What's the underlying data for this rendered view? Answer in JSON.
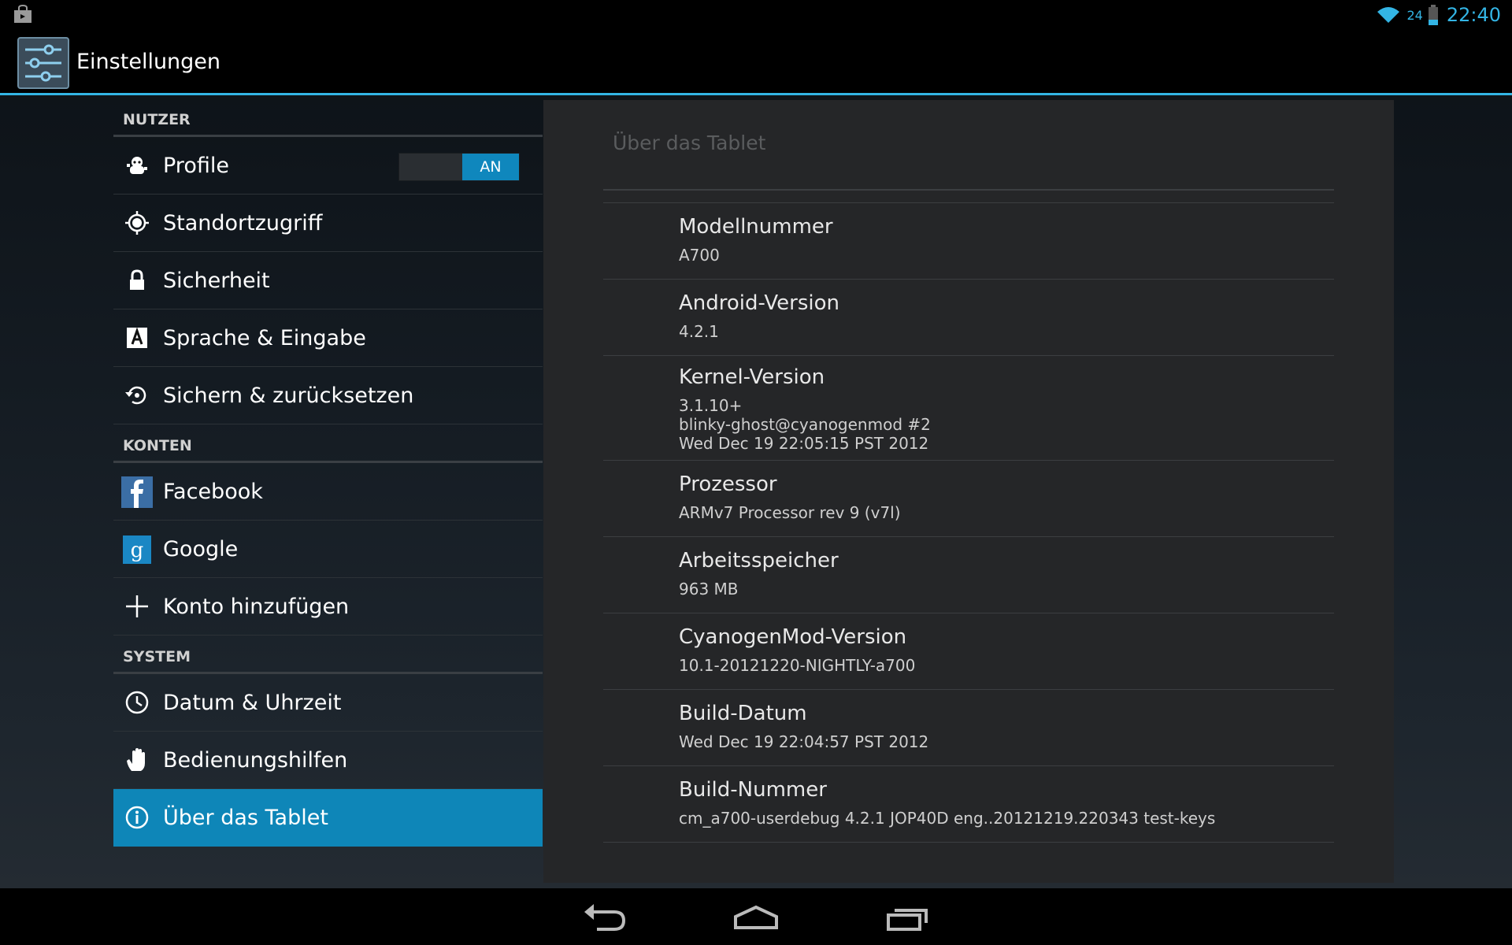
{
  "status_bar": {
    "battery_percent": "24",
    "time": "22:40",
    "accent_color": "#33b5e5"
  },
  "action_bar": {
    "title": "Einstellungen",
    "icon": "settings-sliders-icon"
  },
  "sidebar": {
    "sections": [
      {
        "header": "NUTZER"
      },
      {
        "header": "KONTEN"
      },
      {
        "header": "SYSTEM"
      }
    ],
    "items": [
      {
        "label": "Profile",
        "icon": "profile-icon",
        "toggle": "AN"
      },
      {
        "label": "Standortzugriff",
        "icon": "location-icon"
      },
      {
        "label": "Sicherheit",
        "icon": "lock-icon"
      },
      {
        "label": "Sprache & Eingabe",
        "icon": "language-icon"
      },
      {
        "label": "Sichern & zurücksetzen",
        "icon": "backup-restore-icon"
      },
      {
        "label": "Facebook",
        "icon": "facebook-icon"
      },
      {
        "label": "Google",
        "icon": "google-icon"
      },
      {
        "label": "Konto hinzufügen",
        "icon": "plus-icon"
      },
      {
        "label": "Datum & Uhrzeit",
        "icon": "clock-icon"
      },
      {
        "label": "Bedienungshilfen",
        "icon": "hand-icon"
      },
      {
        "label": "Über das Tablet",
        "icon": "info-icon",
        "selected": true
      }
    ],
    "selected_color": "#0e86b8"
  },
  "detail": {
    "title": "Über das Tablet",
    "rows": [
      {
        "title": "Modellnummer",
        "value": [
          "A700"
        ]
      },
      {
        "title": "Android-Version",
        "value": [
          "4.2.1"
        ]
      },
      {
        "title": "Kernel-Version",
        "value": [
          "3.1.10+",
          "blinky-ghost@cyanogenmod #2",
          "Wed Dec 19 22:05:15 PST 2012"
        ]
      },
      {
        "title": "Prozessor",
        "value": [
          "ARMv7 Processor rev 9 (v7l)"
        ]
      },
      {
        "title": "Arbeitsspeicher",
        "value": [
          "963 MB"
        ]
      },
      {
        "title": "CyanogenMod-Version",
        "value": [
          "10.1-20121220-NIGHTLY-a700"
        ]
      },
      {
        "title": "Build-Datum",
        "value": [
          "Wed Dec 19 22:04:57 PST 2012"
        ]
      },
      {
        "title": "Build-Nummer",
        "value": [
          "cm_a700-userdebug 4.2.1 JOP40D eng..20121219.220343 test-keys"
        ]
      }
    ]
  },
  "nav_bar": {
    "buttons": [
      "back-icon",
      "home-icon",
      "recent-apps-icon"
    ]
  }
}
